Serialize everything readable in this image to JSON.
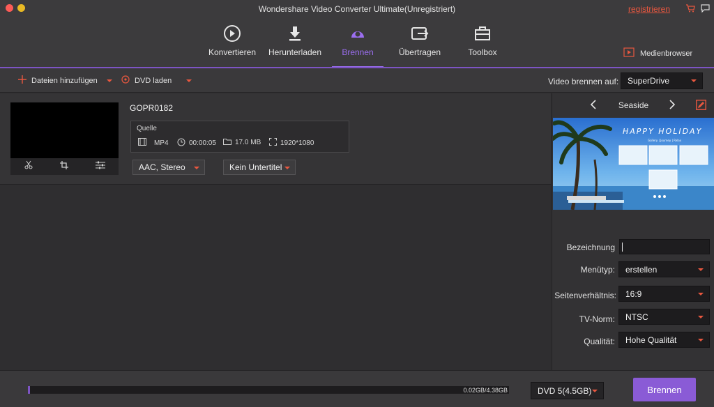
{
  "window": {
    "title": "Wondershare Video Converter Ultimate(Unregistriert)",
    "register_link": "registrieren"
  },
  "nav": [
    {
      "label": "Konvertieren",
      "icon": "convert-icon"
    },
    {
      "label": "Herunterladen",
      "icon": "download-icon"
    },
    {
      "label": "Brennen",
      "icon": "burn-icon",
      "active": true
    },
    {
      "label": "Übertragen",
      "icon": "transfer-icon"
    },
    {
      "label": "Toolbox",
      "icon": "toolbox-icon"
    }
  ],
  "media_browser": "Medienbrowser",
  "toolbar": {
    "add_files": "Dateien hinzufügen",
    "load_dvd": "DVD laden",
    "burn_to_label": "Video brennen auf:",
    "burn_to_value": "SuperDrive"
  },
  "file": {
    "name": "GOPR0182",
    "source_label": "Quelle",
    "format": "MP4",
    "duration": "00:00:05",
    "size": "17.0 MB",
    "resolution": "1920*1080",
    "audio": "AAC, Stereo",
    "subtitle": "Kein Untertitel"
  },
  "template": {
    "name": "Seaside",
    "preview_title": "HAPPY HOLIDAY",
    "preview_menu": "Gallery  |  Journey  |  Relax"
  },
  "settings": {
    "label_label": "Bezeichnung",
    "label_value": "",
    "menu_type_label": "Menütyp:",
    "menu_type_value": "erstellen",
    "aspect_label": "Seitenverhältnis:",
    "aspect_value": "16:9",
    "tv_norm_label": "TV-Norm:",
    "tv_norm_value": "NTSC",
    "quality_label": "Qualität:",
    "quality_value": "Hohe Qualität"
  },
  "bottom": {
    "usage_text": "0.02GB/4.38GB",
    "usage_fraction": 0.005,
    "disc_type": "DVD 5(4.5GB)",
    "burn_button": "Brennen"
  },
  "colors": {
    "accent": "#8a5bd6",
    "highlight": "#e8573f"
  }
}
